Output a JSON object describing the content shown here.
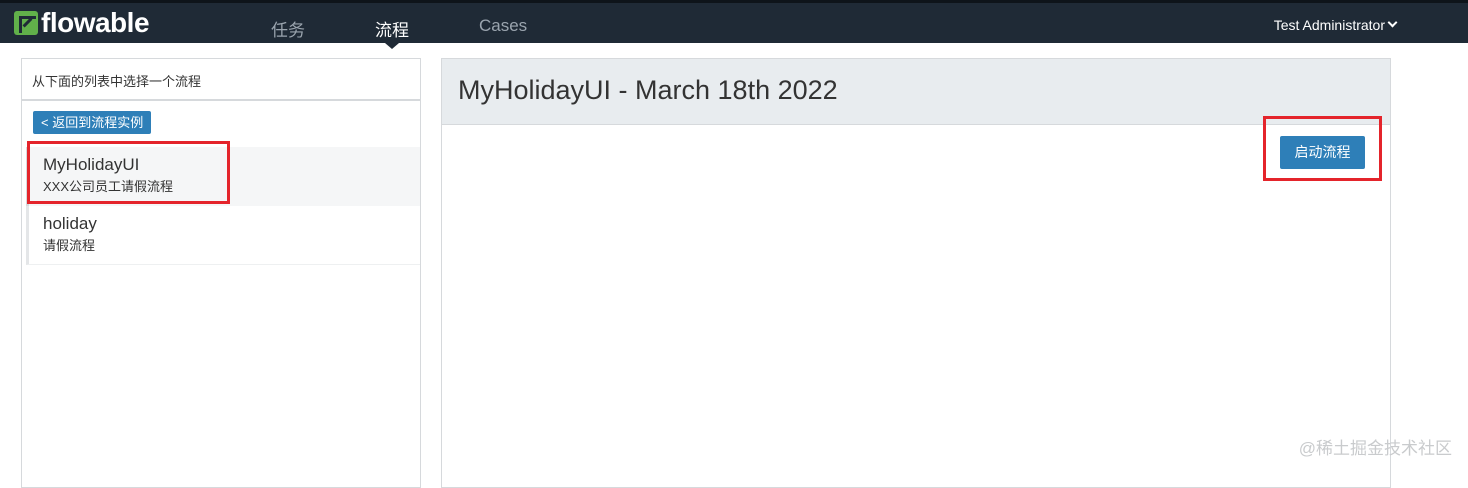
{
  "header": {
    "logo_text": "flowable",
    "nav": [
      {
        "label": "任务"
      },
      {
        "label": "流程"
      },
      {
        "label": "Cases"
      }
    ],
    "active_nav_index": 1,
    "user_name": "Test Administrator"
  },
  "left": {
    "heading": "从下面的列表中选择一个流程",
    "back_label": "< 返回到流程实例",
    "processes": [
      {
        "name": "MyHolidayUI",
        "description": "XXX公司员工请假流程",
        "selected": true
      },
      {
        "name": "holiday",
        "description": "请假流程",
        "selected": false
      }
    ]
  },
  "right": {
    "title": "MyHolidayUI - March 18th 2022",
    "start_label": "启动流程"
  },
  "watermark": "@稀土掘金技术社区",
  "colors": {
    "topbar": "#1f2a36",
    "brand_green": "#61b04a",
    "button_blue": "#2e7fb8",
    "highlight_red": "#e4242b"
  }
}
